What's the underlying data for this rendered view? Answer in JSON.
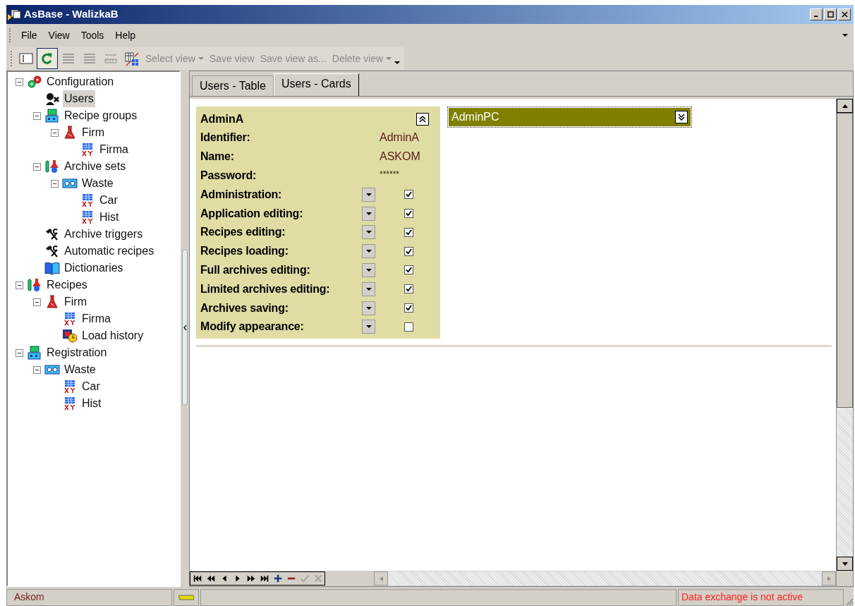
{
  "window": {
    "title": "AsBase - WalizkaB"
  },
  "menu": [
    {
      "label": "File"
    },
    {
      "label": "View"
    },
    {
      "label": "Tools"
    },
    {
      "label": "Help"
    }
  ],
  "toolbar": {
    "icon_buttons": [
      {
        "kind": "field",
        "selected": false,
        "disabled": false
      },
      {
        "kind": "refresh",
        "selected": true,
        "disabled": false
      },
      {
        "kind": "lines",
        "selected": false,
        "disabled": true
      },
      {
        "kind": "lines",
        "selected": false,
        "disabled": true
      },
      {
        "kind": "ruler",
        "selected": false,
        "disabled": true
      },
      {
        "kind": "grid",
        "selected": false,
        "disabled": false
      }
    ],
    "text_buttons": [
      {
        "label": "Select view",
        "dropdown": true,
        "disabled": true
      },
      {
        "label": "Save view",
        "dropdown": false,
        "disabled": true
      },
      {
        "label": "Save view as...",
        "dropdown": false,
        "disabled": true
      },
      {
        "label": "Delete view",
        "dropdown": true,
        "disabled": true
      }
    ]
  },
  "tree": [
    {
      "label": "Configuration",
      "kind": "gears",
      "expanded": true,
      "selected": false,
      "children": [
        {
          "label": "Users",
          "kind": "users",
          "selected": true
        },
        {
          "label": "Recipe groups",
          "kind": "groups",
          "expanded": true,
          "selected": false,
          "children": [
            {
              "label": "Firm",
              "kind": "flask",
              "expanded": true,
              "selected": false,
              "children": [
                {
                  "label": "Firma",
                  "kind": "table",
                  "selected": false
                }
              ]
            }
          ]
        },
        {
          "label": "Archive sets",
          "kind": "archive",
          "expanded": true,
          "selected": false,
          "children": [
            {
              "label": "Waste",
              "kind": "tape",
              "expanded": true,
              "selected": false,
              "children": [
                {
                  "label": "Car",
                  "kind": "table",
                  "selected": false
                },
                {
                  "label": "Hist",
                  "kind": "table",
                  "selected": false
                }
              ]
            }
          ]
        },
        {
          "label": "Archive triggers",
          "kind": "tools",
          "selected": false
        },
        {
          "label": "Automatic recipes",
          "kind": "tools",
          "selected": false
        },
        {
          "label": "Dictionaries",
          "kind": "book",
          "selected": false
        }
      ]
    },
    {
      "label": "Recipes",
      "kind": "archive",
      "expanded": true,
      "selected": false,
      "children": [
        {
          "label": "Firm",
          "kind": "flask",
          "expanded": true,
          "selected": false,
          "children": [
            {
              "label": "Firma",
              "kind": "table",
              "selected": false
            },
            {
              "label": "Load history",
              "kind": "history",
              "selected": false
            }
          ]
        }
      ]
    },
    {
      "label": "Registration",
      "kind": "groups",
      "expanded": true,
      "selected": false,
      "children": [
        {
          "label": "Waste",
          "kind": "tape",
          "expanded": true,
          "selected": false,
          "children": [
            {
              "label": "Car",
              "kind": "table",
              "selected": false
            },
            {
              "label": "Hist",
              "kind": "table",
              "selected": false
            }
          ]
        }
      ]
    }
  ],
  "tabs": [
    {
      "label": "Users - Table",
      "selected": false
    },
    {
      "label": "Users - Cards",
      "selected": true
    }
  ],
  "cards": [
    {
      "title": "AdminA",
      "expanded": true,
      "fields": [
        {
          "kind": "text",
          "label": "Identifier:",
          "value": "AdminA"
        },
        {
          "kind": "text",
          "label": "Name:",
          "value": "ASKOM"
        },
        {
          "kind": "password",
          "label": "Password:",
          "value": "******"
        },
        {
          "kind": "check",
          "label": "Administration:",
          "checked": true
        },
        {
          "kind": "check",
          "label": "Application editing:",
          "checked": true
        },
        {
          "kind": "check",
          "label": "Recipes editing:",
          "checked": true
        },
        {
          "kind": "check",
          "label": "Recipes loading:",
          "checked": true
        },
        {
          "kind": "check",
          "label": "Full archives editing:",
          "checked": true
        },
        {
          "kind": "check",
          "label": "Limited archives editing:",
          "checked": true
        },
        {
          "kind": "check",
          "label": "Archives saving:",
          "checked": true
        },
        {
          "kind": "check",
          "label": "Modify appearance:",
          "checked": false
        }
      ]
    },
    {
      "title": "AdminPC",
      "expanded": false
    }
  ],
  "navigator": [
    {
      "kind": "first",
      "disabled": false
    },
    {
      "kind": "prior-page",
      "disabled": false
    },
    {
      "kind": "prior",
      "disabled": false
    },
    {
      "kind": "next",
      "disabled": false
    },
    {
      "kind": "next-page",
      "disabled": false
    },
    {
      "kind": "last",
      "disabled": false
    },
    {
      "kind": "insert",
      "disabled": false
    },
    {
      "kind": "delete",
      "disabled": false
    },
    {
      "kind": "post",
      "disabled": true
    },
    {
      "kind": "cancel",
      "disabled": true
    }
  ],
  "status_bar": {
    "user": "Askom",
    "message": "Data exchange is not active"
  }
}
